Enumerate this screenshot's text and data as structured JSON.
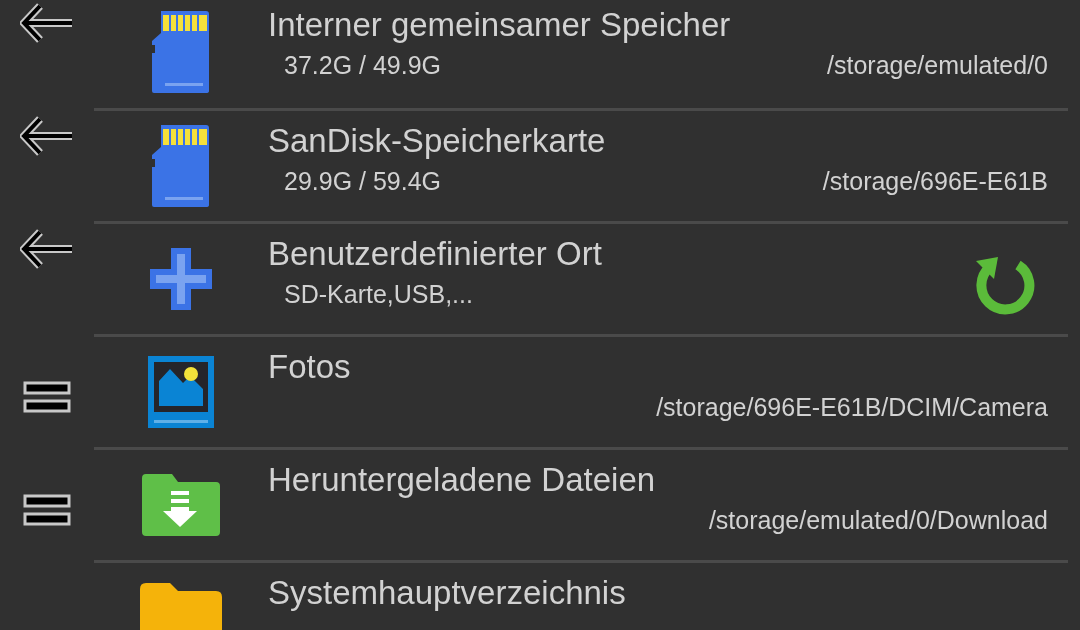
{
  "locations": [
    {
      "title": "Interner gemeinsamer Speicher",
      "usage": "37.2G / 49.9G",
      "path": "/storage/emulated/0",
      "refresh": false
    },
    {
      "title": "SanDisk-Speicherkarte",
      "usage": "29.9G / 59.4G",
      "path": "/storage/696E-E61B",
      "refresh": false
    },
    {
      "title": "Benutzerdefinierter Ort",
      "usage": "SD-Karte,USB,...",
      "refresh": true
    },
    {
      "title": "Fotos",
      "path": "/storage/696E-E61B/DCIM/Camera",
      "refresh": false
    },
    {
      "title": "Heruntergeladene Dateien",
      "path": "/storage/emulated/0/Download",
      "refresh": false
    },
    {
      "title": "Systemhauptverzeichnis",
      "refresh": false
    }
  ]
}
